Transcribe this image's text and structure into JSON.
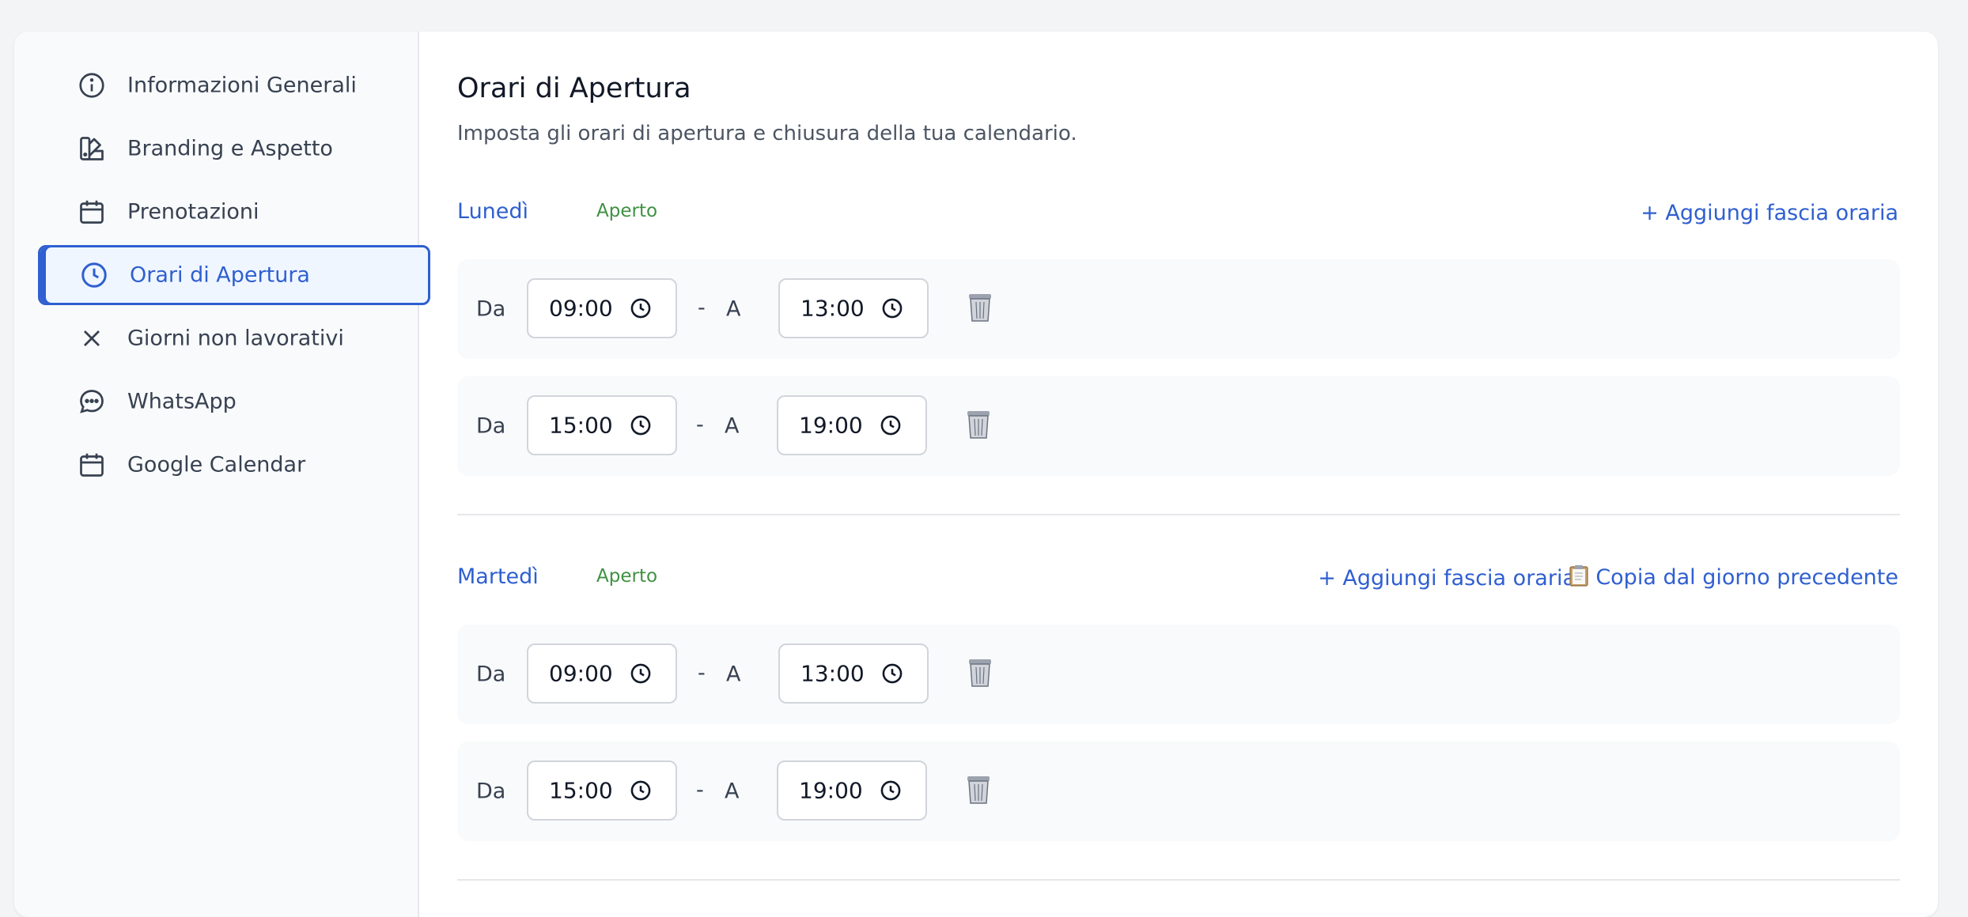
{
  "sidebar": {
    "items": [
      {
        "label": "Informazioni Generali",
        "icon": "info-icon"
      },
      {
        "label": "Branding e Aspetto",
        "icon": "palette-icon"
      },
      {
        "label": "Prenotazioni",
        "icon": "calendar-icon"
      },
      {
        "label": "Orari di Apertura",
        "icon": "clock-icon",
        "active": true
      },
      {
        "label": "Giorni non lavorativi",
        "icon": "close-icon"
      },
      {
        "label": "WhatsApp",
        "icon": "chat-bubble-icon"
      },
      {
        "label": "Google Calendar",
        "icon": "calendar-icon"
      }
    ]
  },
  "main": {
    "title": "Orari di Apertura",
    "subtitle": "Imposta gli orari di apertura e chiusura della tua calendario.",
    "days": [
      {
        "name": "Lunedì",
        "status": "Aperto",
        "add_label": "+ Aggiungi fascia oraria",
        "slots": [
          {
            "from_label": "Da",
            "from": "09:00",
            "sep": "-",
            "to_label": "A",
            "to": "13:00"
          },
          {
            "from_label": "Da",
            "from": "15:00",
            "sep": "-",
            "to_label": "A",
            "to": "19:00"
          }
        ]
      },
      {
        "name": "Martedì",
        "status": "Aperto",
        "add_label": "+ Aggiungi fascia oraria",
        "copy_label": "Copia dal giorno precedente",
        "slots": [
          {
            "from_label": "Da",
            "from": "09:00",
            "sep": "-",
            "to_label": "A",
            "to": "13:00"
          },
          {
            "from_label": "Da",
            "from": "15:00",
            "sep": "-",
            "to_label": "A",
            "to": "19:00"
          }
        ]
      }
    ]
  },
  "colors": {
    "accent": "#2f5fd0",
    "open_status": "#3f9142",
    "page_bg": "#f3f4f6",
    "active_nav_bg": "#eff6ff"
  }
}
